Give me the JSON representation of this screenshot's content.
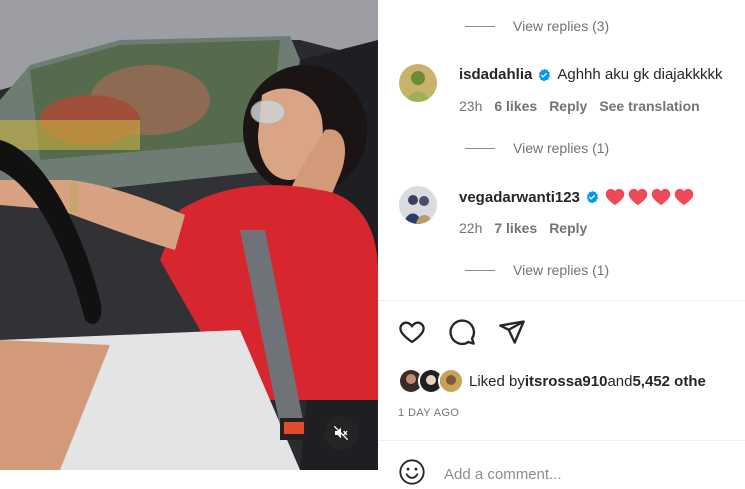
{
  "comments": [
    {
      "view_replies": "View replies (3)"
    },
    {
      "username": "isdadahlia",
      "text": "Aghhh aku gk diajakkkkk",
      "time": "23h",
      "likes": "6 likes",
      "reply": "Reply",
      "translate": "See translation",
      "view_replies": "View replies (1)"
    },
    {
      "username": "vegadarwanti123",
      "text": "",
      "time": "22h",
      "likes": "7 likes",
      "reply": "Reply",
      "view_replies": "View replies (1)"
    }
  ],
  "likes": {
    "prefix": "Liked by ",
    "user": "itsrossa910",
    "middle": " and ",
    "count": "5,452 othe"
  },
  "time_ago": "1 DAY AGO",
  "add_comment": {
    "placeholder": "Add a comment..."
  },
  "colors": {
    "verified": "#0095f6",
    "heart": "#ed4956",
    "shirt": "#d8262f"
  }
}
